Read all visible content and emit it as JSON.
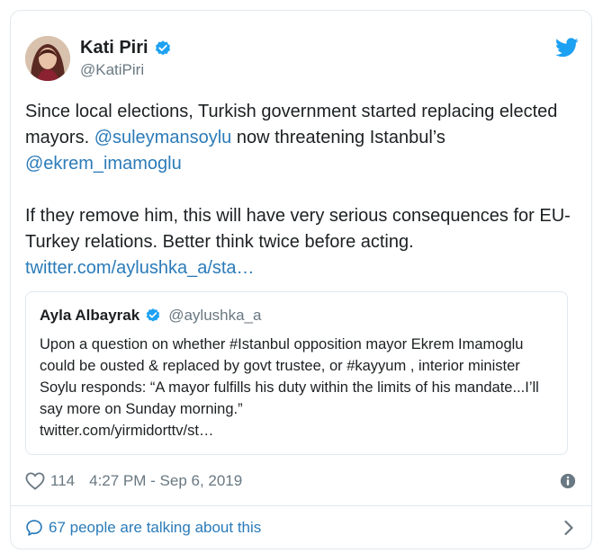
{
  "author": {
    "name": "Kati Piri",
    "handle": "@KatiPiri"
  },
  "tweet": {
    "line1_a": "Since local elections, Turkish government started replacing elected mayors. ",
    "mention1": "@suleymansoylu",
    "line1_b": " now threatening Istanbul’s ",
    "mention2": "@ekrem_imamoglu",
    "para2": "If they remove him, this will have very serious consequences for EU-Turkey relations. Better think twice before acting.",
    "link": "twitter.com/aylushka_a/sta…"
  },
  "quote": {
    "name": "Ayla Albayrak",
    "handle": "@aylushka_a",
    "text": "Upon a question on whether #Istanbul opposition mayor Ekrem Imamoglu could be ousted & replaced by govt trustee, or #kayyum , interior minister Soylu responds: “A mayor fulfills his duty within the limits of his mandate...I’ll say more on Sunday morning.”",
    "link": "twitter.com/yirmidorttv/st…"
  },
  "footer": {
    "likes": "114",
    "timestamp": "4:27 PM - Sep 6, 2019"
  },
  "talking": {
    "label": "67 people are talking about this"
  },
  "icons": {
    "verified": "verified-badge-icon",
    "bird": "twitter-bird-icon",
    "heart": "heart-icon",
    "info": "info-icon",
    "bubble": "speech-bubble-icon",
    "chevron": "chevron-right-icon"
  },
  "colors": {
    "link": "#2b7bb9",
    "verified": "#1da1f2",
    "muted": "#697882"
  }
}
